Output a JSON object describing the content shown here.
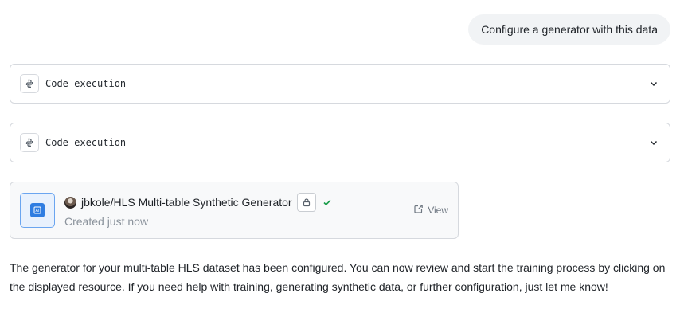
{
  "user_message": "Configure a generator with this data",
  "code_blocks": [
    {
      "label": "Code execution",
      "icon": "code-execution-icon",
      "expand_icon": "chevron-down-icon"
    },
    {
      "label": "Code execution",
      "icon": "code-execution-icon",
      "expand_icon": "chevron-down-icon"
    }
  ],
  "resource": {
    "title": "jbkole/HLS Multi-table Synthetic Generator",
    "subtitle": "Created just now",
    "view_label": "View",
    "icon": "generator-icon",
    "status_icon": "check-icon",
    "lock_icon": "lock-icon",
    "accent_color": "#2f7de1",
    "success_color": "#1a9c4a"
  },
  "assistant_message": "The generator for your multi-table HLS dataset has been configured. You can now review and start the training process by clicking on the displayed resource. If you need help with training, generating synthetic data, or further configuration, just let me know!"
}
